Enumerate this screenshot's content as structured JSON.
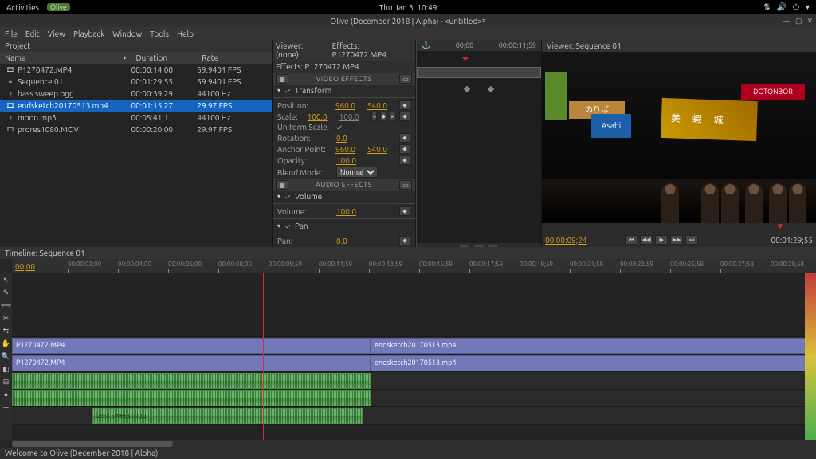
{
  "gnome": {
    "activities": "Activities",
    "app": "Olive",
    "time": "Thu Jan  3, 10:49"
  },
  "window": {
    "title": "Olive (December 2018 | Alpha) - <untitled>*"
  },
  "menu": [
    "File",
    "Edit",
    "View",
    "Playback",
    "Window",
    "Tools",
    "Help"
  ],
  "project": {
    "title": "Project",
    "cols": [
      "Name",
      "Duration",
      "Rate"
    ],
    "rows": [
      {
        "icon": "film",
        "name": "P1270472.MP4",
        "dur": "00:00:14;00",
        "rate": "59.9401 FPS"
      },
      {
        "icon": "seq",
        "name": "Sequence 01",
        "dur": "00:01:29;55",
        "rate": "59.9401 FPS"
      },
      {
        "icon": "aud",
        "name": "bass sweep.ogg",
        "dur": "00:00:39;29",
        "rate": "44100 Hz"
      },
      {
        "icon": "film",
        "name": "endsketch20170513.mp4",
        "dur": "00:01:15;27",
        "rate": "29.97 FPS",
        "selected": true
      },
      {
        "icon": "aud",
        "name": "moon.mp3",
        "dur": "00:05:41;11",
        "rate": "44100 Hz"
      },
      {
        "icon": "film",
        "name": "prores1080.MOV",
        "dur": "00:00:20;00",
        "rate": "29.97 FPS"
      }
    ]
  },
  "effects": {
    "viewerNone": "Viewer: (none)",
    "effectsTab": "Effects: P1270472.MP4",
    "sub": "Effects: P1270472.MP4",
    "videoEffects": "VIDEO EFFECTS",
    "audioEffects": "AUDIO EFFECTS",
    "transform": "Transform",
    "volume": "Volume",
    "pan": "Pan",
    "props": {
      "position": "Position:",
      "posX": "960.0",
      "posY": "540.0",
      "scale": "Scale:",
      "scaleX": "100.0",
      "scaleY": "100.0",
      "uniform": "Uniform Scale:",
      "rotation": "Rotation:",
      "rotVal": "0.0",
      "anchor": "Anchor Point:",
      "anX": "960.0",
      "anY": "540.0",
      "opacity": "Opacity:",
      "opVal": "100.0",
      "blend": "Blend Mode:",
      "blendVal": "Normal",
      "volLabel": "Volume:",
      "volVal": "100.0",
      "panLabel": "Pan:",
      "panVal": "0.0"
    },
    "miniRuler": {
      "start": "00;00",
      "end": "00:00:11;59"
    }
  },
  "viewer": {
    "title": "Viewer: Sequence 01",
    "tcLeft": "00:00:09;24",
    "tcRight": "00:01:29;55",
    "signs": {
      "asahi": "Asahi",
      "noriba": "のりば",
      "doton": "DOTONBOR",
      "kanji": "",
      "green": ""
    }
  },
  "timeline": {
    "title": "Timeline: Sequence 01",
    "tc": "00;00",
    "ticks": [
      "00:00:02;00",
      "00:00:04;00",
      "00:00:06;00",
      "00:00:08;00",
      "00:00:09;59",
      "00:00:11;59",
      "00:00:13;59",
      "00:00:15;59",
      "00:00:17;59",
      "00:00:19;59",
      "00:00:21;59",
      "00:00:23;59",
      "00:00:25;58",
      "00:00:27;58",
      "00:00:29;58"
    ],
    "clips": {
      "v1a": "P1270472.MP4",
      "v1b": "endsketch20170513.mp4",
      "v2a": "P1270472.MP4",
      "v2b": "endsketch20170513.mp4",
      "a1": "bass sweep.ogg"
    }
  },
  "status": "Welcome to Olive (December 2018 | Alpha)"
}
